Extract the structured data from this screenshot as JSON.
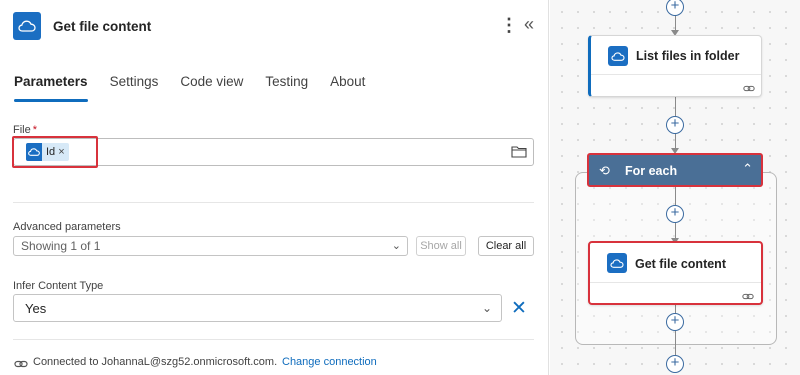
{
  "panel": {
    "title": "Get file content",
    "tabs": [
      {
        "label": "Parameters",
        "active": true
      },
      {
        "label": "Settings",
        "active": false
      },
      {
        "label": "Code view",
        "active": false
      },
      {
        "label": "Testing",
        "active": false
      },
      {
        "label": "About",
        "active": false
      }
    ],
    "file": {
      "label": "File",
      "required_marker": "*",
      "token_label": "Id",
      "token_remove": "×"
    },
    "advanced": {
      "label": "Advanced parameters",
      "selected": "Showing 1 of 1",
      "show_all": "Show all",
      "clear_all": "Clear all"
    },
    "infer": {
      "label": "Infer Content Type",
      "selected": "Yes"
    },
    "connection": {
      "text": "Connected to JohannaL@szg52.onmicrosoft.com.",
      "change": "Change connection"
    },
    "accent_color": "#0f6cbd",
    "highlight_color": "#d8323c"
  },
  "canvas": {
    "list_files": {
      "title": "List files in folder"
    },
    "for_each": {
      "title": "For each"
    },
    "get_file": {
      "title": "Get file content"
    },
    "plus_symbol": "+",
    "icons": [
      "onedrive-icon",
      "link-icon",
      "loop-icon",
      "chevron-up-icon"
    ]
  }
}
